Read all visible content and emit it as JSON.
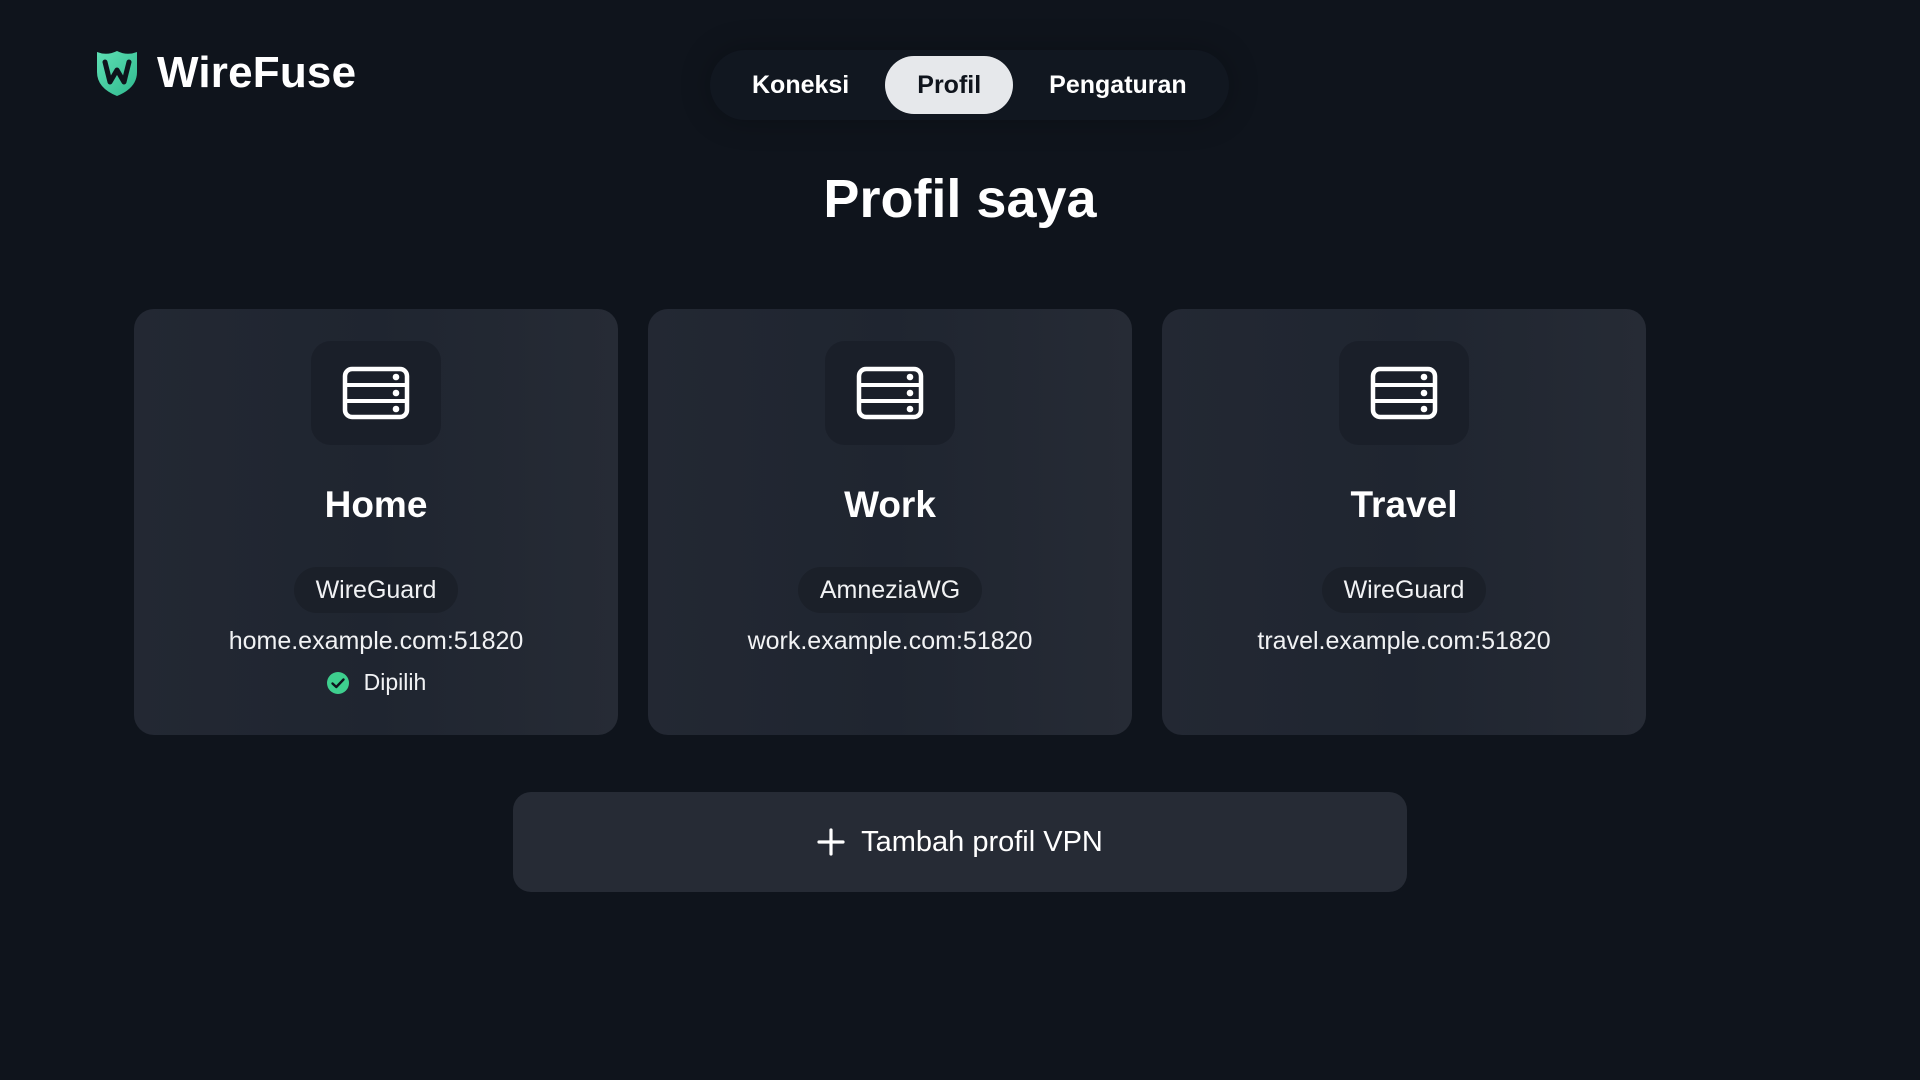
{
  "app": {
    "name": "WireFuse",
    "brand_color": "#4fd1a5"
  },
  "nav": {
    "tabs": [
      {
        "label": "Koneksi",
        "active": false
      },
      {
        "label": "Profil",
        "active": true
      },
      {
        "label": "Pengaturan",
        "active": false
      }
    ]
  },
  "page": {
    "title": "Profil saya"
  },
  "profiles": [
    {
      "name": "Home",
      "protocol": "WireGuard",
      "endpoint": "home.example.com:51820",
      "selected": true,
      "status_label": "Dipilih",
      "icon": "server-icon"
    },
    {
      "name": "Work",
      "protocol": "AmneziaWG",
      "endpoint": "work.example.com:51820",
      "selected": false,
      "icon": "server-icon"
    },
    {
      "name": "Travel",
      "protocol": "WireGuard",
      "endpoint": "travel.example.com:51820",
      "selected": false,
      "icon": "server-icon"
    }
  ],
  "actions": {
    "add_profile_label": "Tambah profil VPN",
    "add_icon": "plus-icon"
  },
  "colors": {
    "background": "#0f141c",
    "card": "#232833",
    "active_tab": "#e6e8eb",
    "status_ok": "#3ecf8e"
  }
}
